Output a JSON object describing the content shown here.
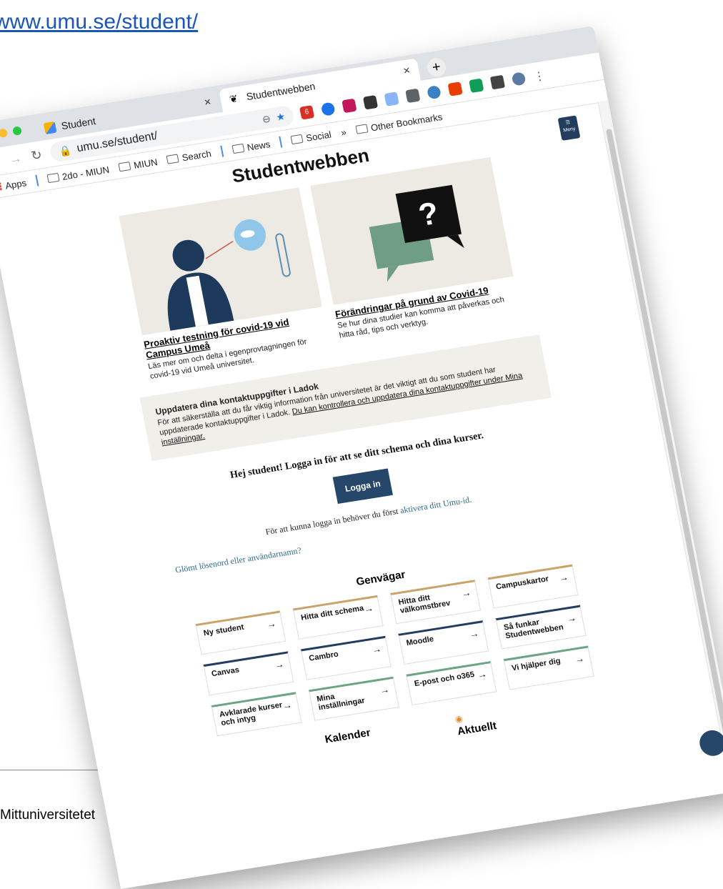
{
  "slide": {
    "link_text": "www.umu.se/student/",
    "footer_text": "Mittuniversitetet"
  },
  "browser": {
    "tabs": [
      {
        "label": "Student"
      },
      {
        "label": "Studentwebben"
      }
    ],
    "url": "umu.se/student/",
    "extension_badge": "6",
    "bookmarks": {
      "apps_label": "Apps",
      "items": [
        "2do - MIUN",
        "MIUN",
        "Search",
        "News",
        "Social"
      ],
      "more": "»",
      "other": "Other Bookmarks"
    }
  },
  "page": {
    "menu_label": "Meny",
    "title": "Studentwebben",
    "cards": [
      {
        "title": "Proaktiv testning för covid-19 vid Campus Umeå",
        "text": "Läs mer om och delta i egenprovtagningen för covid-19 vid Umeå universitet."
      },
      {
        "title": "Förändringar på grund av Covid-19",
        "text": "Se hur dina studier kan komma att påverkas och hitta råd, tips och verktyg."
      }
    ],
    "notice": {
      "title": "Uppdatera dina kontaktuppgifter i Ladok",
      "text": "För att säkerställa att du får viktig information från universitetet är det viktigt att du som student har uppdaterade kontaktuppgifter i Ladok. ",
      "link": "Du kan kontrollera och uppdatera dina kontaktuppgifter under Mina inställningar."
    },
    "login": {
      "greeting": "Hej student! Logga in för att se ditt schema och dina kurser.",
      "button": "Logga in",
      "info_prefix": "För att kunna logga in behöver du först ",
      "info_link": "aktivera ditt Umu-id.",
      "forgot": "Glömt lösenord eller användarnamn?"
    },
    "shortcuts_heading": "Genvägar",
    "shortcuts": [
      "Ny student",
      "Hitta ditt schema",
      "Hitta ditt välkomstbrev",
      "Campuskartor",
      "Canvas",
      "Cambro",
      "Moodle",
      "Så funkar Studentwebben",
      "Avklarade kurser och intyg",
      "Mina inställningar",
      "E-post och o365",
      "Vi hjälper dig"
    ],
    "calendar_heading": "Kalender",
    "news_heading": "Aktuellt"
  },
  "colors": {
    "umu_navy": "#26466a",
    "tile_gold": "#c9a46a",
    "tile_green": "#6aa586",
    "link_blue": "#1a55b8"
  }
}
